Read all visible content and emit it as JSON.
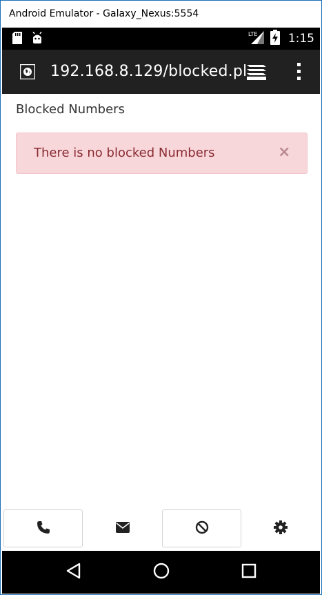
{
  "window": {
    "title": "Android Emulator - Galaxy_Nexus:5554"
  },
  "status_bar": {
    "time": "1:15",
    "network_label": "LTE",
    "icons": [
      "sd-card-icon",
      "android-debug-icon",
      "lte-signal-icon",
      "battery-charging-icon"
    ]
  },
  "browser": {
    "url": "192.168.8.129/blocked.pl",
    "icons": [
      "site-globe-icon",
      "tabs-stack-icon",
      "overflow-menu-icon"
    ]
  },
  "page": {
    "title": "Blocked Numbers",
    "alert": {
      "message": "There is no blocked Numbers",
      "close_label": "×"
    }
  },
  "tab_bar": {
    "tabs": [
      {
        "name": "phone",
        "icon": "phone-icon",
        "boxed": true
      },
      {
        "name": "messages",
        "icon": "envelope-icon",
        "boxed": false
      },
      {
        "name": "blocked",
        "icon": "ban-icon",
        "boxed": true
      },
      {
        "name": "settings",
        "icon": "gear-icon",
        "boxed": false
      }
    ]
  },
  "nav_bar": {
    "buttons": [
      "back-icon",
      "home-icon",
      "recent-apps-icon"
    ]
  },
  "colors": {
    "status_bar_bg": "#000000",
    "app_bar_bg": "#212121",
    "alert_bg": "#f8d7da",
    "alert_text": "#8a2a32",
    "tab_icon": "#222222",
    "window_border": "#1a6fb5"
  }
}
